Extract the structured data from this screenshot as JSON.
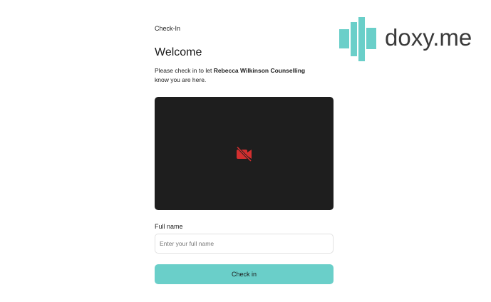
{
  "breadcrumb": "Check-In",
  "heading": "Welcome",
  "intro": {
    "prefix": "Please check in to let ",
    "provider": "Rebecca Wilkinson Counselling",
    "suffix": "know you are here."
  },
  "video": {
    "status_icon": "camera-off-icon",
    "icon_color": "#d32f2f"
  },
  "form": {
    "name_label": "Full name",
    "name_value": "",
    "name_placeholder": "Enter your full name",
    "submit_label": "Check in"
  },
  "brand": {
    "name": "doxy.me",
    "accent": "#6acfc9"
  }
}
